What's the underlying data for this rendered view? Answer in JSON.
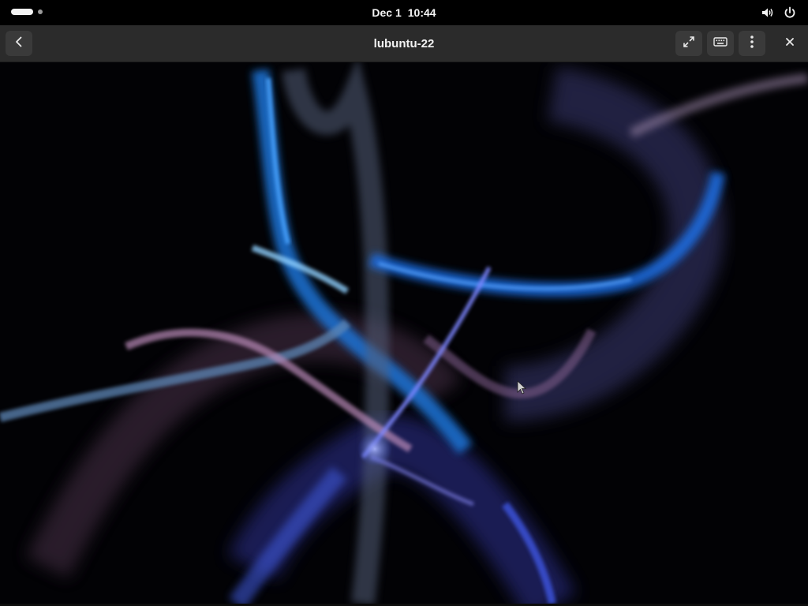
{
  "topbar": {
    "date": "Dec 1",
    "time": "10:44",
    "icons": [
      "volume-icon",
      "power-icon"
    ]
  },
  "header": {
    "title": "lubuntu-22",
    "buttons": [
      "back-icon",
      "fullscreen-icon",
      "keyboard-icon",
      "menu-icon",
      "close-icon"
    ]
  },
  "colors": {
    "topbar_bg": "#000000",
    "headerbar_bg": "#2b2b2b",
    "button_bg": "#3a3a3a",
    "wallpaper_accent_blue": "#2f7fe0",
    "wallpaper_accent_pink": "#b98ab8"
  }
}
